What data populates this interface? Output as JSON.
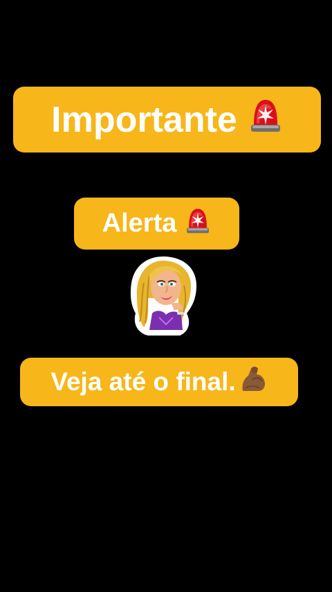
{
  "background_color": "#000000",
  "accent_color": "#F7B619",
  "captions": [
    {
      "text": "Importante",
      "icon": "police-siren-icon"
    },
    {
      "text": "Alerta",
      "icon": "police-siren-icon"
    },
    {
      "text": "Veja até o final.",
      "icon": "flexed-biceps-icon"
    }
  ],
  "sticker": {
    "icon": "cartoon-woman-sticker"
  }
}
